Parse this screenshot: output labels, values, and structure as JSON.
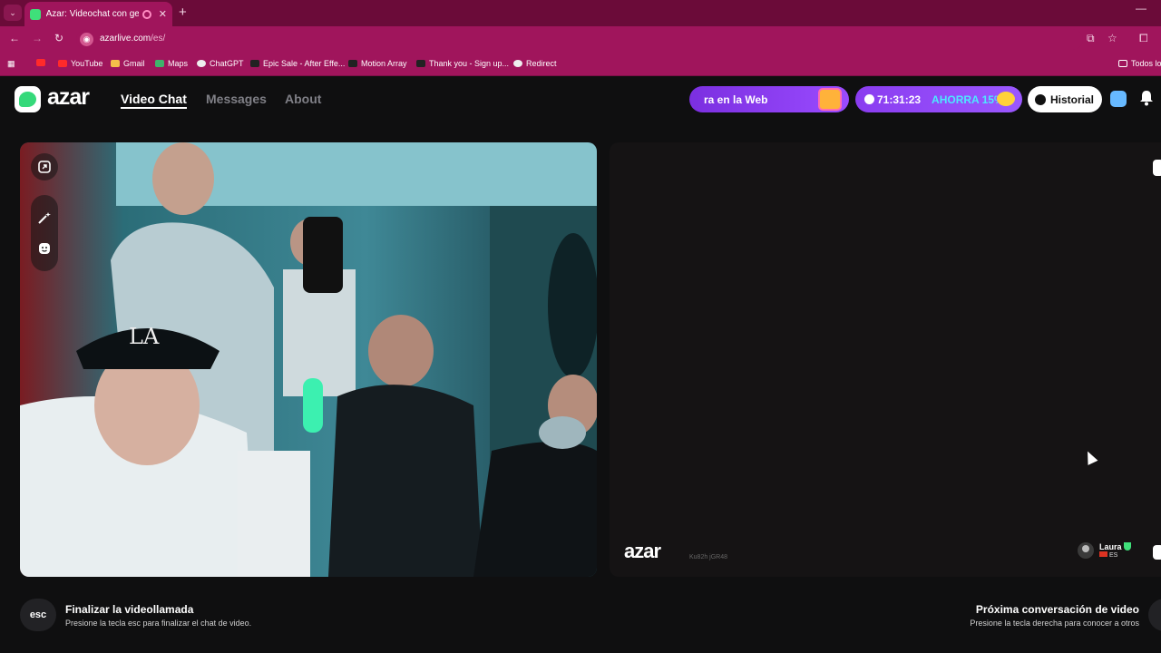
{
  "browser": {
    "tab_title": "Azar: Videochat con gente",
    "url_host": "azarlive.com",
    "url_path": "/es/",
    "bookmarks": [
      "YouTube",
      "Gmail",
      "Maps",
      "ChatGPT",
      "Epic Sale - After Effe...",
      "Motion Array",
      "Thank you - Sign up...",
      "Redirect"
    ],
    "bookmarks_all": "Todos lo"
  },
  "header": {
    "logo": "azar",
    "nav": [
      "Video Chat",
      "Messages",
      "About"
    ],
    "promo_web": "ra en la Web",
    "promo_timer": "71:31:23",
    "promo_save": "AHORRA 15%",
    "history": "Historial"
  },
  "remote": {
    "logo": "azar",
    "session_id": "Ku82h jGR48",
    "peer_name": "Laura",
    "peer_country": "ES"
  },
  "footer": {
    "esc_key": "esc",
    "end_title": "Finalizar la videollamada",
    "end_sub": "Presione la tecla esc para finalizar el chat de video.",
    "next_title": "Próxima conversación de video",
    "next_sub": "Presione la tecla derecha para conocer a otros"
  },
  "colors": {
    "browser_accent": "#a0155c",
    "brand_green": "#35d97a",
    "promo_purple": "#8a3cf0"
  }
}
